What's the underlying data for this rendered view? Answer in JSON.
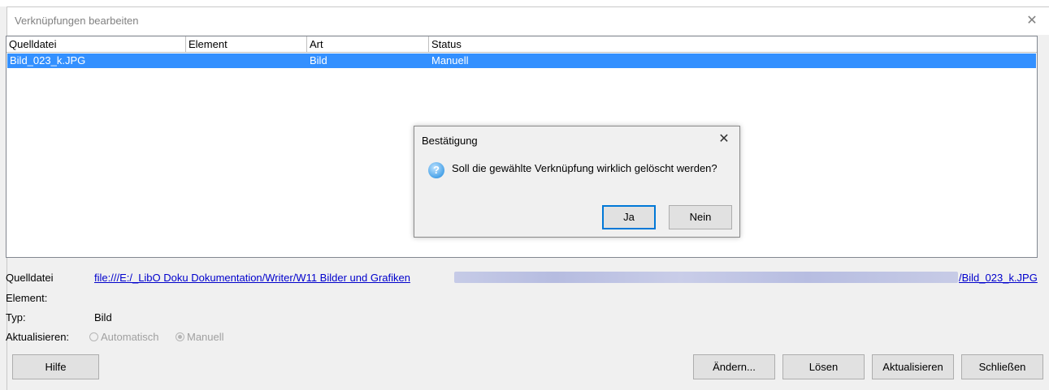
{
  "window": {
    "title": "Verknüpfungen bearbeiten",
    "close_glyph": "✕"
  },
  "table": {
    "columns": [
      "Quelldatei",
      "Element",
      "Art",
      "Status"
    ],
    "rows": [
      {
        "quelldatei": "Bild_023_k.JPG",
        "element": "",
        "art": "Bild",
        "status": "Manuell"
      }
    ]
  },
  "info": {
    "source_label": "Quelldatei",
    "source_link_start": "file:///E:/_LibO Doku Dokumentation/Writer/W11 Bilder und Grafiken",
    "source_link_end": "/Bild_023_k.JPG",
    "element_label": "Element:",
    "element_value": "",
    "type_label": "Typ:",
    "type_value": "Bild",
    "update_label": "Aktualisieren:",
    "update_options": {
      "automatic": "Automatisch",
      "manual": "Manuell"
    },
    "update_selected": "Manuell"
  },
  "buttons": {
    "help": "Hilfe",
    "modify": "Ändern...",
    "break_link": "Lösen",
    "update": "Aktualisieren",
    "close": "Schließen"
  },
  "dialog": {
    "title": "Bestätigung",
    "icon": "question-icon",
    "message": "Soll die gewählte Verknüpfung wirklich gelöscht werden?",
    "yes": "Ja",
    "no": "Nein",
    "close_glyph": "✕"
  },
  "colors": {
    "selection": "#3390ff",
    "link": "#0000cc",
    "default_button_border": "#0078d7"
  }
}
